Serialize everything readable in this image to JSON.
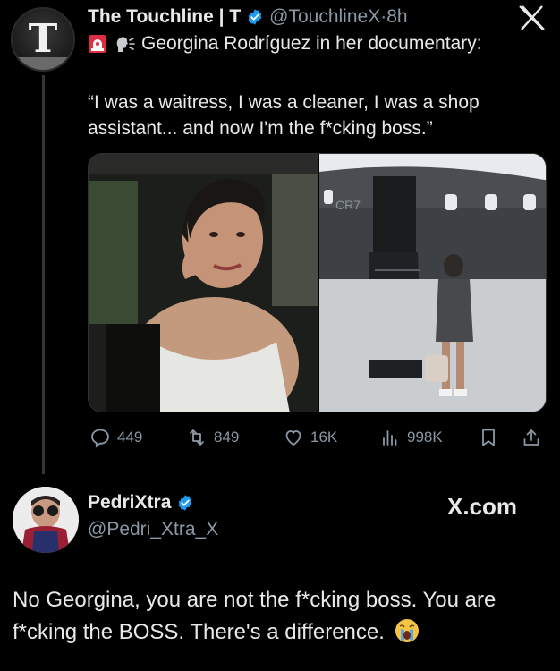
{
  "tweet": {
    "author_name": "The Touchline | T",
    "handle": "@TouchlineX",
    "separator": "·",
    "time": "8h",
    "avatar_letter": "T",
    "subline": "Georgina Rodríguez in her documentary:",
    "subline_icons": [
      "siren-icon",
      "speaking-head-icon"
    ],
    "quote": "“I was a waitress, I was a cleaner, I was a shop assistant... and now I'm the f*cking boss.”",
    "media": [
      {
        "description_icon": "woman-in-car-photo"
      },
      {
        "description_icon": "private-jet-photo",
        "jet_text": "CR7"
      }
    ],
    "actions": {
      "replies": "449",
      "reposts": "849",
      "likes": "16K",
      "views": "998K"
    }
  },
  "reply_card": {
    "author_name": "PedriXtra",
    "handle": "@Pedri_Xtra_X",
    "watermark": "X.com",
    "text": "No Georgina, you are not the f*cking boss. You are f*cking the BOSS. There's a difference."
  },
  "colors": {
    "background": "#000000",
    "text": "#e7e9ea",
    "secondary": "#8b98a5",
    "verified": "#1d9bf0"
  }
}
